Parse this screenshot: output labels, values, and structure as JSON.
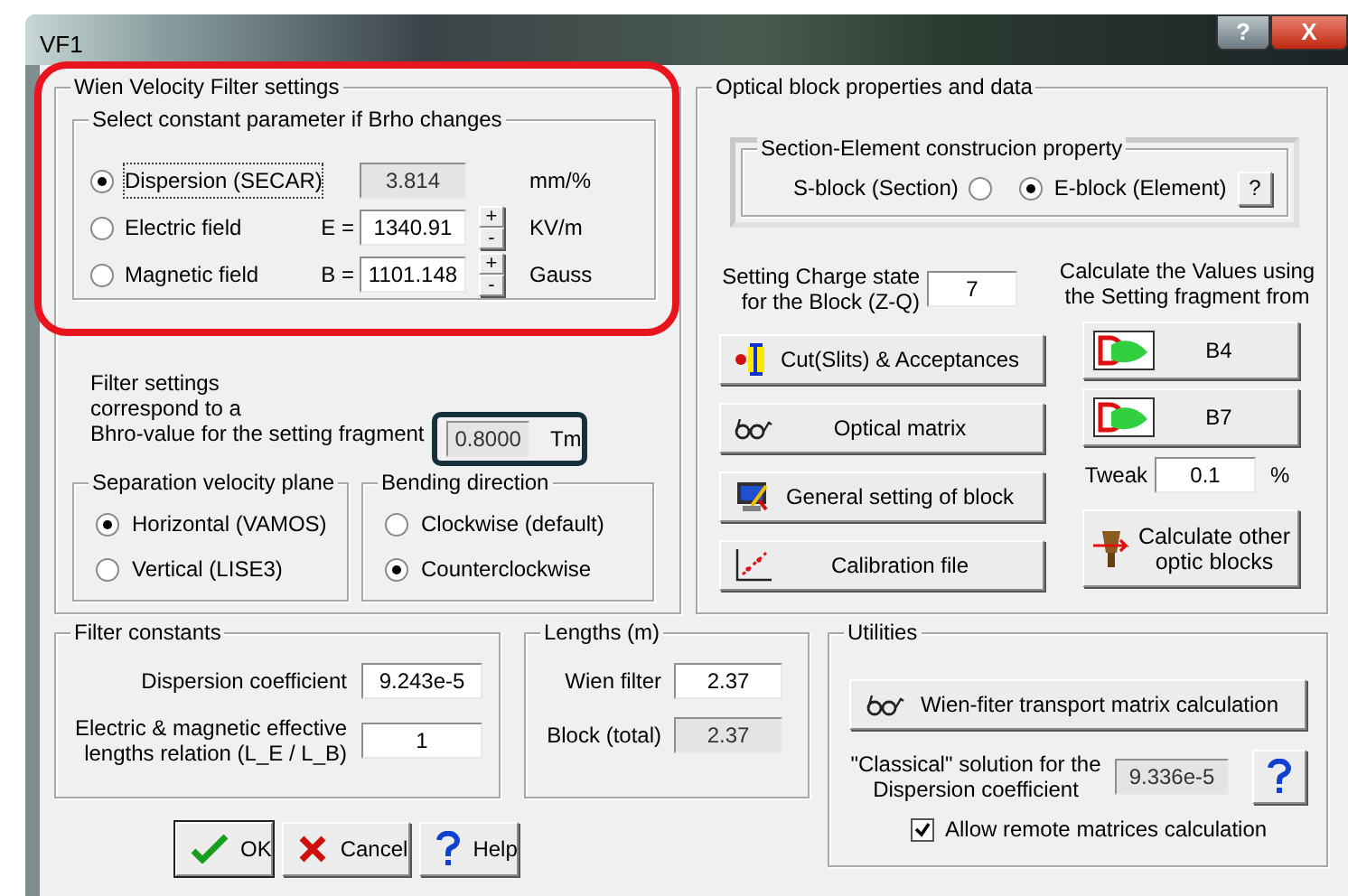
{
  "window": {
    "title": "VF1",
    "buttons": [
      {
        "label": "?",
        "kind": "help"
      },
      {
        "label": "X",
        "kind": "close"
      }
    ]
  },
  "highlights": [
    {
      "color": "#e8141e"
    },
    {
      "color": "#17303a"
    }
  ],
  "wien_filter": {
    "title": "Wien Velocity Filter settings",
    "constant_parameter": {
      "title": "Select constant parameter if Brho changes",
      "options": [
        {
          "label": "Dispersion (SECAR)",
          "selected": true,
          "value": "3.814",
          "readonly": true,
          "unit": "mm/%"
        },
        {
          "label": "Electric field",
          "selected": false,
          "prefix": "E =",
          "value": "1340.91",
          "readonly": false,
          "stepper": [
            "+",
            "-"
          ],
          "unit": "KV/m"
        },
        {
          "label": "Magnetic field",
          "selected": false,
          "prefix": "B =",
          "value": "1101.148",
          "readonly": false,
          "stepper": [
            "+",
            "-"
          ],
          "unit": "Gauss"
        }
      ]
    },
    "brho": {
      "lines": [
        "Filter settings",
        "correspond to a",
        "Bhro-value for the setting fragment"
      ],
      "value": "0.8000",
      "unit": "Tm"
    },
    "separation_plane": {
      "title": "Separation velocity plane",
      "options": [
        {
          "label": "Horizontal (VAMOS)",
          "selected": true
        },
        {
          "label": "Vertical (LISE3)",
          "selected": false
        }
      ]
    },
    "bending_direction": {
      "title": "Bending direction",
      "options": [
        {
          "label": "Clockwise (default)",
          "selected": false
        },
        {
          "label": "Counterclockwise",
          "selected": true
        }
      ]
    }
  },
  "optical_block": {
    "title": "Optical block properties and data",
    "section_element": {
      "title": "Section-Element construcion property",
      "options": [
        {
          "label": "S-block (Section)",
          "selected": false,
          "kind": "label-left"
        },
        {
          "label": "E-block (Element)",
          "selected": true,
          "kind": "label-right"
        }
      ],
      "help": "?"
    },
    "charge_state": {
      "lines": [
        "Setting Charge state",
        "for the Block (Z-Q)"
      ],
      "value": "7"
    },
    "actions": [
      {
        "label": "Cut(Slits) & Acceptances",
        "kind": "slits"
      },
      {
        "label": "Optical matrix",
        "kind": "glasses"
      },
      {
        "label": "General setting of block",
        "kind": "monitor"
      },
      {
        "label": "Calibration file",
        "kind": "graph"
      }
    ],
    "calculate": {
      "lines": [
        "Calculate the Values using",
        "the Setting fragment from"
      ],
      "fragments": [
        {
          "label": "B4"
        },
        {
          "label": "B7"
        }
      ],
      "tweak": {
        "label": "Tweak",
        "value": "0.1",
        "unit": "%"
      },
      "other_button": "Calculate other optic blocks"
    }
  },
  "filter_constants": {
    "title": "Filter constants",
    "rows": [
      {
        "label": "Dispersion coefficient",
        "value": "9.243e-5"
      },
      {
        "label": "Electric & magnetic effective lengths relation (L_E / L_B)",
        "value": "1"
      }
    ]
  },
  "lengths": {
    "title": "Lengths (m)",
    "rows": [
      {
        "label": "Wien filter",
        "value": "2.37",
        "readonly": false
      },
      {
        "label": "Block (total)",
        "value": "2.37",
        "readonly": true
      }
    ]
  },
  "utilities": {
    "title": "Utilities",
    "button": "Wien-fiter transport matrix calculation",
    "classical": {
      "label": "\"Classical\" solution for the Dispersion coefficient",
      "value": "9.336e-5"
    },
    "remote": {
      "label": "Allow remote matrices calculation",
      "checked": true
    }
  },
  "dialog_buttons": [
    {
      "label": "OK",
      "kind": "ok"
    },
    {
      "label": "Cancel",
      "kind": "cancel"
    },
    {
      "label": "Help",
      "kind": "help"
    }
  ]
}
